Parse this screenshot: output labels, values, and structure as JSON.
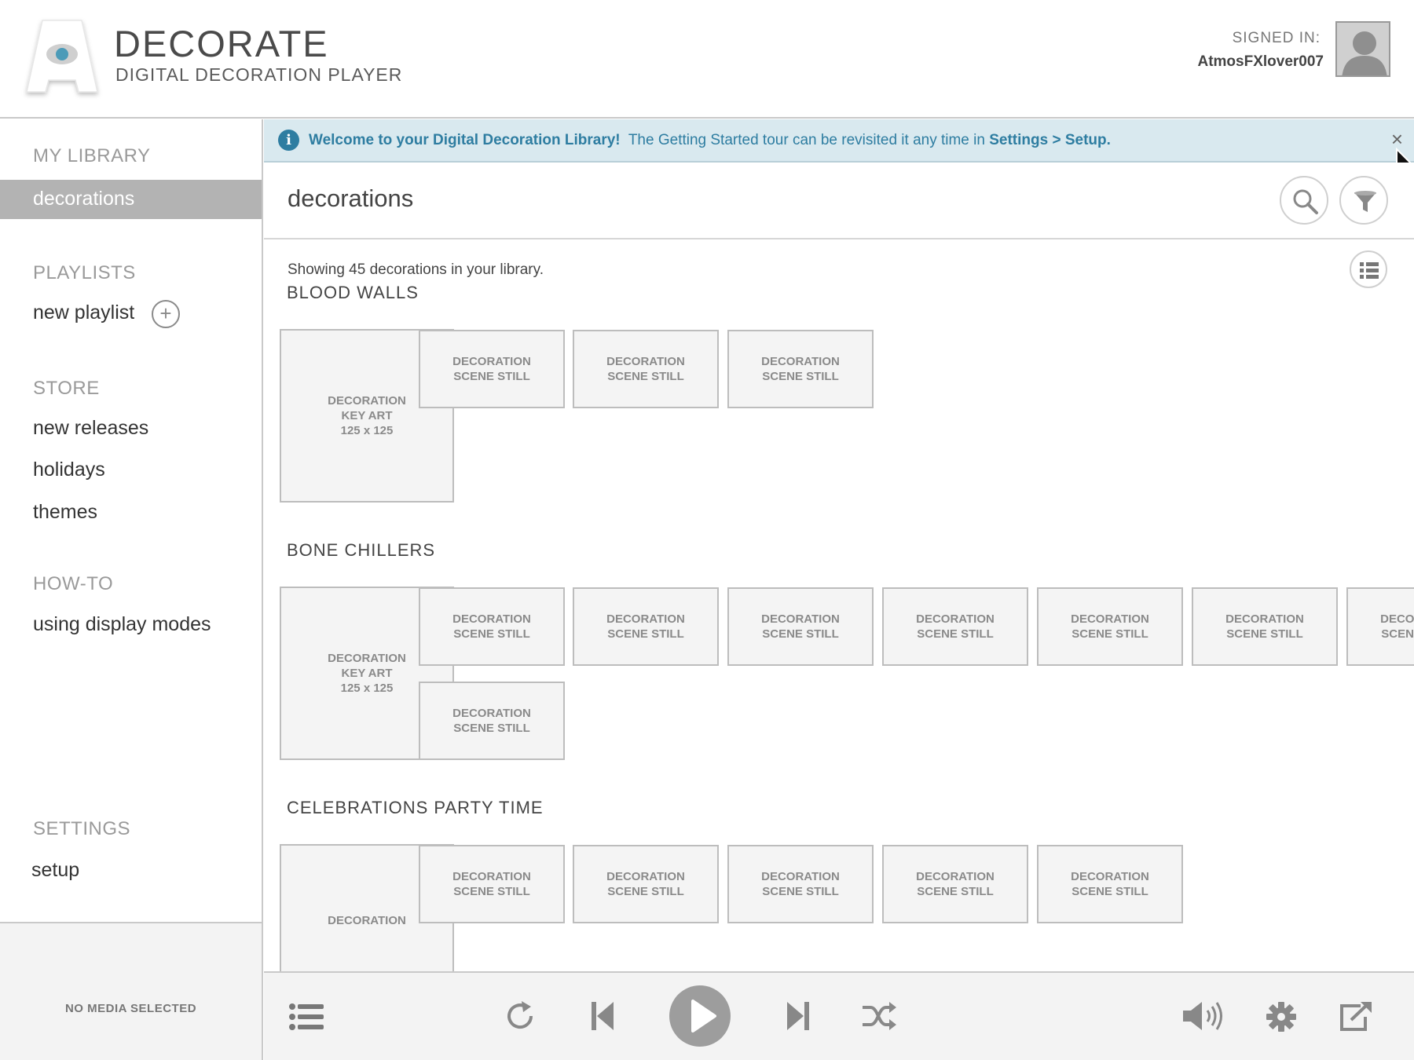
{
  "app": {
    "title": "DECORATE",
    "subtitle": "DIGITAL DECORATION PLAYER"
  },
  "account": {
    "signed_in_label": "SIGNED IN:",
    "username": "AtmosFXlover007"
  },
  "sidebar": {
    "my_library": {
      "heading": "MY LIBRARY",
      "items": [
        {
          "label": "decorations",
          "selected": true
        }
      ]
    },
    "playlists": {
      "heading": "PLAYLISTS",
      "new_playlist": "new playlist"
    },
    "store": {
      "heading": "STORE",
      "items": [
        "new releases",
        "holidays",
        "themes"
      ]
    },
    "howto": {
      "heading": "HOW-TO",
      "items": [
        "using display modes"
      ]
    },
    "settings": {
      "heading": "SETTINGS",
      "items": [
        "setup"
      ]
    },
    "now_playing": "NO MEDIA SELECTED"
  },
  "banner": {
    "bold": "Welcome to your Digital Decoration Library!",
    "text": "The Getting Started tour can be revisited it any time in",
    "link": "Settings > Setup."
  },
  "main": {
    "title": "decorations",
    "showing": "Showing 45 decorations in your library.",
    "key_art_text": "DECORATION\nKEY ART\n125 x 125",
    "still_text": "DECORATION\nSCENE STILL",
    "partial_key_art_text": "DECORATION",
    "sections": [
      {
        "title": "BLOOD WALLS",
        "stills": 3
      },
      {
        "title": "BONE CHILLERS",
        "stills": 8
      },
      {
        "title": "CELEBRATIONS PARTY TIME",
        "stills": 5
      }
    ]
  },
  "colors": {
    "accent": "#2e7da1",
    "banner_bg": "#d9e9ef",
    "selected_bg": "#b3b3b3"
  },
  "icons": [
    "info-icon",
    "close-icon",
    "search-icon",
    "filter-icon",
    "list-view-icon",
    "queue-icon",
    "repeat-icon",
    "previous-icon",
    "play-icon",
    "next-icon",
    "shuffle-icon",
    "volume-icon",
    "gear-icon",
    "external-display-icon",
    "plus-icon",
    "user-icon"
  ]
}
